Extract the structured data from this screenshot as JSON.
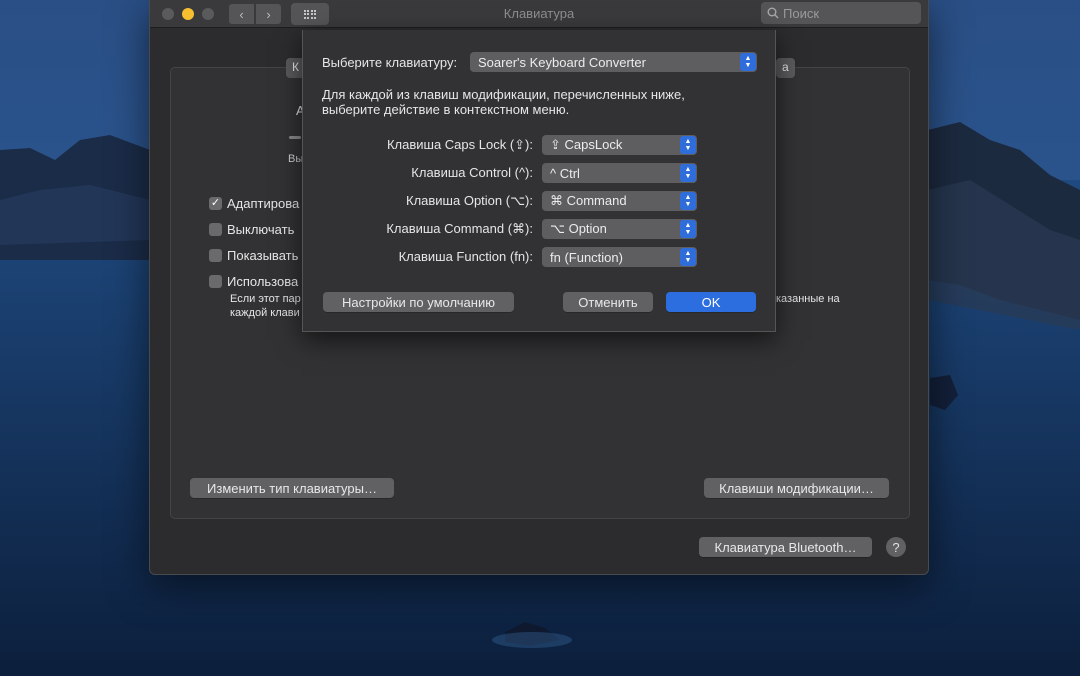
{
  "window": {
    "title": "Клавиатура",
    "search_placeholder": "Поиск"
  },
  "background_panel": {
    "tab_fragment_left": "К",
    "tab_fragment_right": "а",
    "label_fragment_a": "А",
    "label_fragment_vy": "Вы",
    "checkboxes": [
      {
        "label": "Адаптирова",
        "checked": true
      },
      {
        "label": "Выключать",
        "checked": false
      },
      {
        "label": "Показывать",
        "checked": false
      },
      {
        "label": "Использова",
        "checked": false
      }
    ],
    "description_line1_left": "Если этот пар",
    "description_line1_right": "казанные на",
    "description_line2_left": "каждой клави",
    "change_type_button": "Изменить тип клавиатуры…",
    "modifier_keys_button": "Клавиши модификации…",
    "bluetooth_button": "Клавиатура Bluetooth…",
    "help_button": "?"
  },
  "sheet": {
    "select_keyboard_label": "Выберите клавиатуру:",
    "selected_keyboard": "Soarer's Keyboard Converter",
    "instruction_line1": "Для каждой из клавиш модификации, перечисленных ниже,",
    "instruction_line2": "выберите действие в контекстном меню.",
    "rows": [
      {
        "label": "Клавиша Caps Lock (⇪):",
        "value": "⇪ CapsLock"
      },
      {
        "label": "Клавиша Control (^):",
        "value": "^ Ctrl"
      },
      {
        "label": "Клавиша Option (⌥):",
        "value": "⌘ Command"
      },
      {
        "label": "Клавиша Command (⌘):",
        "value": "⌥ Option"
      },
      {
        "label": "Клавиша Function (fn):",
        "value": "fn (Function)"
      }
    ],
    "defaults_button": "Настройки по умолчанию",
    "cancel_button": "Отменить",
    "ok_button": "OK"
  },
  "colors": {
    "accent": "#2c6ee0",
    "window_bg": "#2c2c2e",
    "minimize": "#f5bf2f"
  }
}
